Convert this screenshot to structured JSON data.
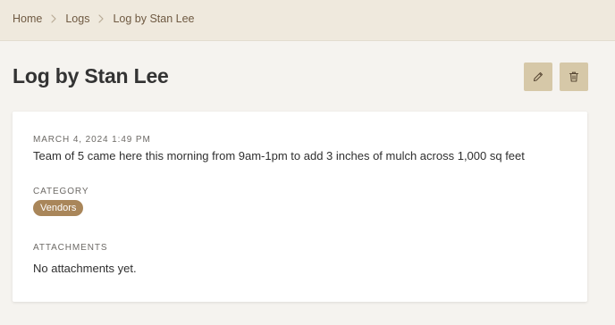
{
  "breadcrumb": {
    "home": "Home",
    "logs": "Logs",
    "current": "Log by Stan Lee"
  },
  "page": {
    "title": "Log by Stan Lee"
  },
  "actions": {
    "edit_icon": "pencil-icon",
    "delete_icon": "trash-icon"
  },
  "log": {
    "timestamp": "MARCH 4, 2024 1:49 PM",
    "description": "Team of 5 came here this morning from 9am-1pm to add 3 inches of mulch across 1,000 sq feet",
    "category_label": "CATEGORY",
    "category": "Vendors",
    "attachments_label": "ATTACHMENTS",
    "attachments_empty": "No attachments yet."
  },
  "colors": {
    "accent_badge": "#a9865a",
    "button_bg": "#d6c8a8",
    "topbar_bg": "#efe9dd",
    "page_bg": "#f5f3ef"
  }
}
